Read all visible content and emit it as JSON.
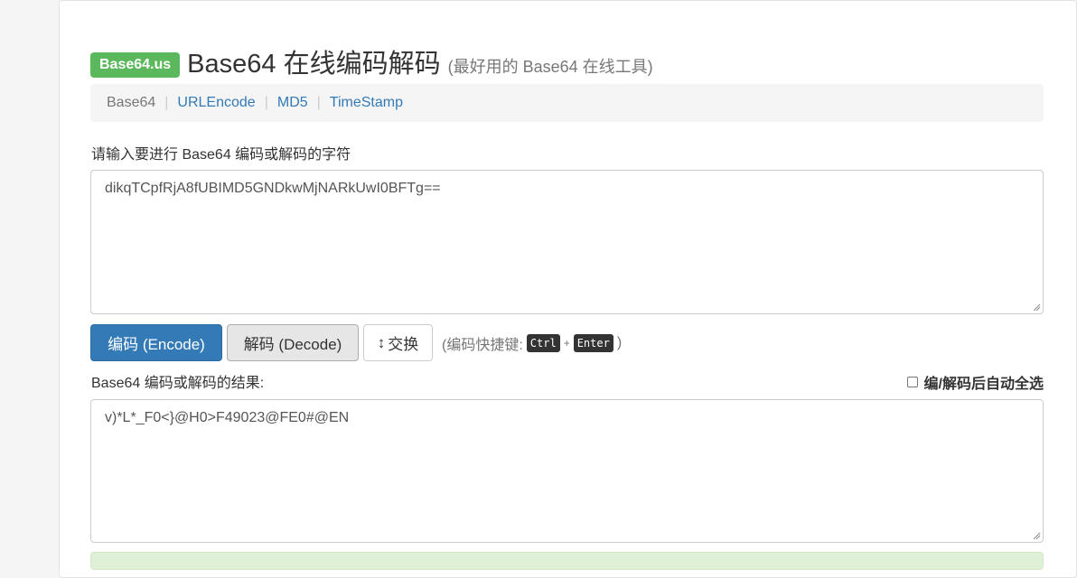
{
  "header": {
    "badge": "Base64.us",
    "title": "Base64 在线编码解码",
    "subtitle": "(最好用的 Base64 在线工具)"
  },
  "nav": {
    "items": [
      {
        "label": "Base64",
        "active": true
      },
      {
        "label": "URLEncode",
        "active": false
      },
      {
        "label": "MD5",
        "active": false
      },
      {
        "label": "TimeStamp",
        "active": false
      }
    ],
    "separator": "|"
  },
  "input": {
    "label": "请输入要进行 Base64 编码或解码的字符",
    "value": "dikqTCpfRjA8fUBIMD5GNDkwMjNARkUwI0BFTg=="
  },
  "actions": {
    "encode_label": "编码 (Encode)",
    "decode_label": "解码 (Decode)",
    "swap_icon": "↕",
    "swap_label": "交换",
    "hint_prefix": "(编码快捷键:",
    "key_ctrl": "Ctrl",
    "key_plus": "+",
    "key_enter": "Enter",
    "hint_suffix": ")"
  },
  "output": {
    "label": "Base64 编码或解码的结果:",
    "auto_select_label": "编/解码后自动全选",
    "auto_select_checked": false,
    "value": "v)*L*_F0<}@H0>F49023@FE0#@EN"
  },
  "colors": {
    "brand": "#5cb85c",
    "primary": "#337ab7",
    "link": "#337ab7"
  }
}
